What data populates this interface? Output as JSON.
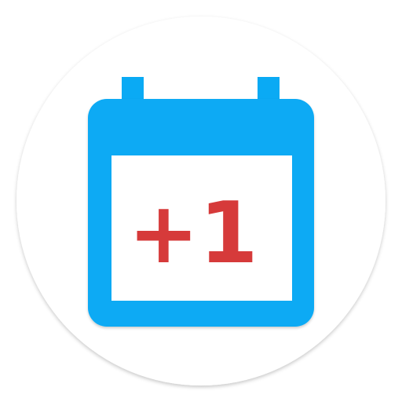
{
  "app_icon": {
    "name": "calendar-plus-one-app-icon",
    "badge_text": "+1",
    "colors": {
      "background_circle": "#ffffff",
      "calendar_blue": "#0aaaf4",
      "calendar_blue_shadow": "#0b83c7",
      "page_background": "#ffffff",
      "plus_one_red": "#d63a3a"
    }
  }
}
